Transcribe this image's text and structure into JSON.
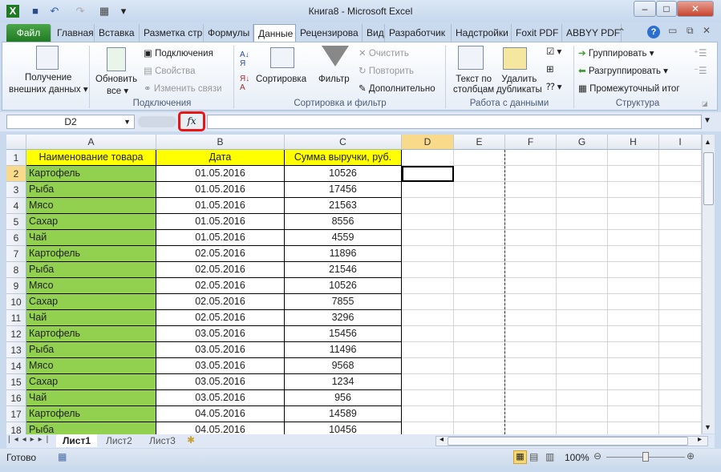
{
  "window": {
    "title": "Книга8  -  Microsoft Excel"
  },
  "tabs": [
    "Файл",
    "Главная",
    "Вставка",
    "Разметка стр",
    "Формулы",
    "Данные",
    "Рецензирова",
    "Вид",
    "Разработчик",
    "Надстройки",
    "Foxit PDF",
    "ABBYY PDF Tra"
  ],
  "active_tab": "Данные",
  "ribbon": {
    "get_external": [
      "Получение",
      "внешних данных"
    ],
    "refresh": [
      "Обновить",
      "все"
    ],
    "connections": "Подключения",
    "properties": "Свойства",
    "edit_links": "Изменить связи",
    "group_connections": "Подключения",
    "sort": "Сортировка",
    "filter": "Фильтр",
    "clear": "Очистить",
    "reapply": "Повторить",
    "advanced": "Дополнительно",
    "group_sort": "Сортировка и фильтр",
    "text_to_cols": [
      "Текст по",
      "столбцам"
    ],
    "remove_dup": [
      "Удалить",
      "дубликаты"
    ],
    "group_data": "Работа с данными",
    "group": "Группировать",
    "ungroup": "Разгруппировать",
    "subtotal": "Промежуточный итог",
    "group_outline": "Структура"
  },
  "formula_bar": {
    "name_box": "D2",
    "fx": "fx",
    "formula": ""
  },
  "columns": [
    "A",
    "B",
    "C",
    "D",
    "E",
    "F",
    "G",
    "H",
    "I"
  ],
  "header_row": [
    "Наименование товара",
    "Дата",
    "Сумма выручки, руб."
  ],
  "rows": [
    [
      "Картофель",
      "01.05.2016",
      "10526"
    ],
    [
      "Рыба",
      "01.05.2016",
      "17456"
    ],
    [
      "Мясо",
      "01.05.2016",
      "21563"
    ],
    [
      "Сахар",
      "01.05.2016",
      "8556"
    ],
    [
      "Чай",
      "01.05.2016",
      "4559"
    ],
    [
      "Картофель",
      "02.05.2016",
      "11896"
    ],
    [
      "Рыба",
      "02.05.2016",
      "21546"
    ],
    [
      "Мясо",
      "02.05.2016",
      "10526"
    ],
    [
      "Сахар",
      "02.05.2016",
      "7855"
    ],
    [
      "Чай",
      "02.05.2016",
      "3296"
    ],
    [
      "Картофель",
      "03.05.2016",
      "15456"
    ],
    [
      "Рыба",
      "03.05.2016",
      "11496"
    ],
    [
      "Мясо",
      "03.05.2016",
      "9568"
    ],
    [
      "Сахар",
      "03.05.2016",
      "1234"
    ],
    [
      "Чай",
      "03.05.2016",
      "956"
    ],
    [
      "Картофель",
      "04.05.2016",
      "14589"
    ],
    [
      "Рыба",
      "04.05.2016",
      "10456"
    ]
  ],
  "colors": {
    "header_fill": "#ffff00",
    "name_fill": "#92d050",
    "highlight": "#e81515"
  },
  "sheets": [
    "Лист1",
    "Лист2",
    "Лист3"
  ],
  "active_sheet": "Лист1",
  "status": {
    "text": "Готово",
    "zoom": "100%"
  }
}
